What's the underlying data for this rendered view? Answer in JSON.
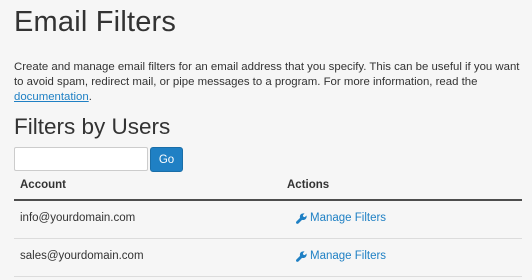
{
  "page": {
    "title": "Email Filters",
    "intro_text": "Create and manage email filters for an email address that you specify. This can be useful if you want to avoid spam, redirect mail, or pipe messages to a program. For more information, read the ",
    "intro_link_label": "documentation",
    "intro_suffix": "."
  },
  "filters_section": {
    "title": "Filters by Users",
    "search": {
      "value": "",
      "placeholder": ""
    },
    "go_label": "Go",
    "table": {
      "columns": [
        "Account",
        "Actions"
      ],
      "rows": [
        {
          "account": "info@yourdomain.com",
          "action_label": "Manage Filters",
          "action_icon": "wrench-icon"
        },
        {
          "account": "sales@yourdomain.com",
          "action_label": "Manage Filters",
          "action_icon": "wrench-icon"
        }
      ]
    }
  },
  "colors": {
    "accent": "#1f80c4",
    "text": "#333333",
    "background": "#f6f6f6"
  }
}
